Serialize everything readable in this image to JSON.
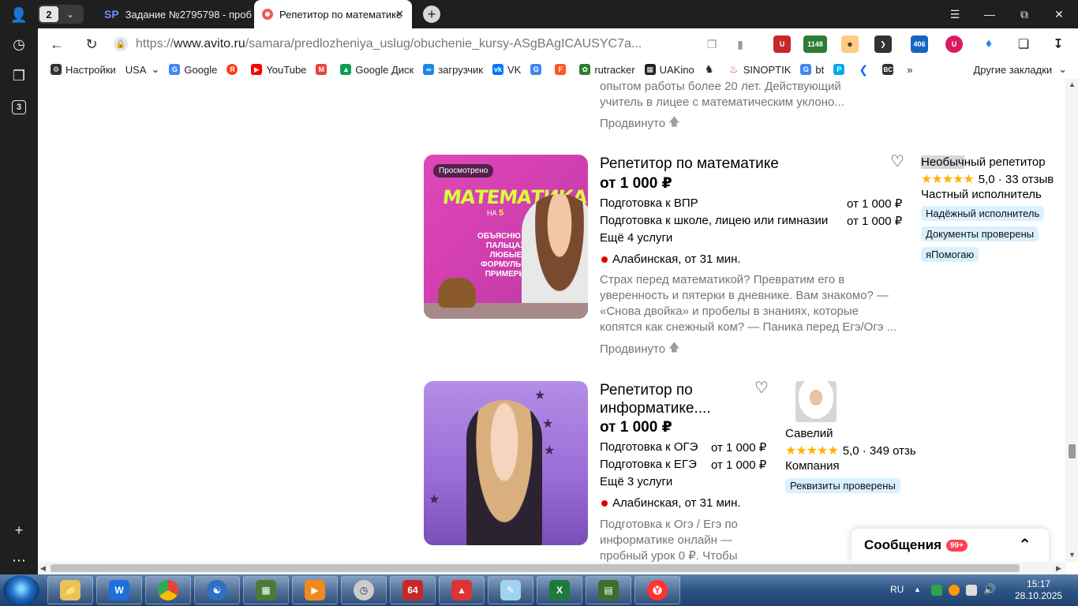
{
  "browser": {
    "tab_count": "2",
    "tabs": [
      {
        "label": "Задание №2795798 - проб",
        "icon": "SP"
      },
      {
        "label": "Репетитор по математике"
      }
    ],
    "url_prefix": "https://",
    "url_domain": "www.avito.ru",
    "url_path": "/samara/predlozheniya_uslug/obuchenie_kursy-ASgBAgICAUSYC7a...",
    "sidebar_badge": "3",
    "ext_labels": [
      "1148",
      "406"
    ]
  },
  "bookmarks": [
    {
      "label": "Настройки",
      "icon": "gear-icon",
      "color": "#333333"
    },
    {
      "label": "USA",
      "icon": "dropdown",
      "color": "#333333"
    },
    {
      "label": "Google",
      "icon": "google-icon",
      "color": "#4285f4"
    },
    {
      "label": "",
      "icon": "yandex-icon",
      "color": "#fc3f1d"
    },
    {
      "label": "YouTube",
      "icon": "youtube-icon",
      "color": "#ff0000"
    },
    {
      "label": "",
      "icon": "gmail-icon",
      "color": "#ea4335"
    },
    {
      "label": "Google Диск",
      "icon": "drive-icon",
      "color": "#0f9d58"
    },
    {
      "label": "загрузчик",
      "icon": "loader-icon",
      "color": "#1e88e5"
    },
    {
      "label": "VK",
      "icon": "vk-icon",
      "color": "#0077ff"
    },
    {
      "label": "",
      "icon": "translate-icon",
      "color": "#4285f4"
    },
    {
      "label": "",
      "icon": "f-icon",
      "color": "#ff5722"
    },
    {
      "label": "rutracker",
      "icon": "rutracker-icon",
      "color": "#2e7d32"
    },
    {
      "label": "UAKino",
      "icon": "uakino-icon",
      "color": "#222222"
    },
    {
      "label": "",
      "icon": "chess-icon",
      "color": "#222222"
    },
    {
      "label": "SINOPTIK",
      "icon": "thermometer-icon",
      "color": "#e53935"
    },
    {
      "label": "bt",
      "icon": "google-icon",
      "color": "#4285f4"
    },
    {
      "label": "",
      "icon": "p-icon",
      "color": "#03a9f4"
    },
    {
      "label": "",
      "icon": "arrow-icon",
      "color": "#1e66f5"
    },
    {
      "label": "",
      "icon": "bc-icon",
      "color": "#333333"
    }
  ],
  "bookmarks_more": "»",
  "bookmarks_other": "Другие закладки",
  "listing_prev": {
    "desc_line1": "опытом работы более 20 лет. Действующий",
    "desc_line2": "учитель в лицее с математическим уклоно...",
    "promoted": "Продвинуто"
  },
  "listing1": {
    "seen_label": "Просмотрено",
    "image_heading": "МАТЕМАТИКА",
    "image_na": "НА",
    "image_five": "5",
    "image_text": "ОБЪЯСНЮ НА ПАЛЬЦАХ ЛЮБЫЕ ФОРМУЛЫ И ПРИМЕРЫ",
    "title": "Репетитор по математике",
    "price": "от 1 000 ₽",
    "services": [
      {
        "name": "Подготовка к ВПР",
        "price": "от 1 000 ₽"
      },
      {
        "name": "Подготовка к школе, лицею или гимназии",
        "price": "от 1 000 ₽"
      }
    ],
    "more_services": "Ещё 4 услуги",
    "metro": "Алабинская, от 31 мин.",
    "description": [
      "Страх перед математикой? Превратим его в",
      "уверенность и пятерки в дневнике. Вам знакомо? —",
      "«Снова двойка» и пробелы в знаниях, которые",
      "копятся как снежный ком? — Паника перед Егэ/Огэ ..."
    ],
    "promoted": "Продвинуто",
    "seller": {
      "name_highlight": "Необыч",
      "name_rest": "ный репетитор",
      "stars": "★★★★★",
      "rating": "5,0 · 33 отзыв",
      "type": "Частный исполнитель",
      "badges": [
        "Надёжный исполнитель",
        "Документы проверены",
        "яПомогаю"
      ]
    }
  },
  "listing2": {
    "title_line1": "Репетитор по",
    "title_line2": "информатике....",
    "price": "от 1 000 ₽",
    "services": [
      {
        "name": "Подготовка к ОГЭ",
        "price": "от 1 000 ₽"
      },
      {
        "name": "Подготовка к ЕГЭ",
        "price": "от 1 000 ₽"
      }
    ],
    "more_services": "Ещё 3 услуги",
    "metro": "Алабинская, от 31 мин.",
    "description": [
      "Подготовка к Огэ / Егэ по",
      "информатике онлайн —",
      "пробный урок 0 ₽. Чтобы"
    ],
    "seller": {
      "name": "Савелий",
      "stars": "★★★★★",
      "rating": "5,0 · 349 отзь",
      "type": "Компания",
      "badges": [
        "Реквизиты проверены"
      ]
    }
  },
  "messages": {
    "title": "Сообщения",
    "count": "99+"
  },
  "taskbar": {
    "lang": "RU",
    "time": "15:17",
    "date": "28.10.2025",
    "app_64": "64"
  }
}
